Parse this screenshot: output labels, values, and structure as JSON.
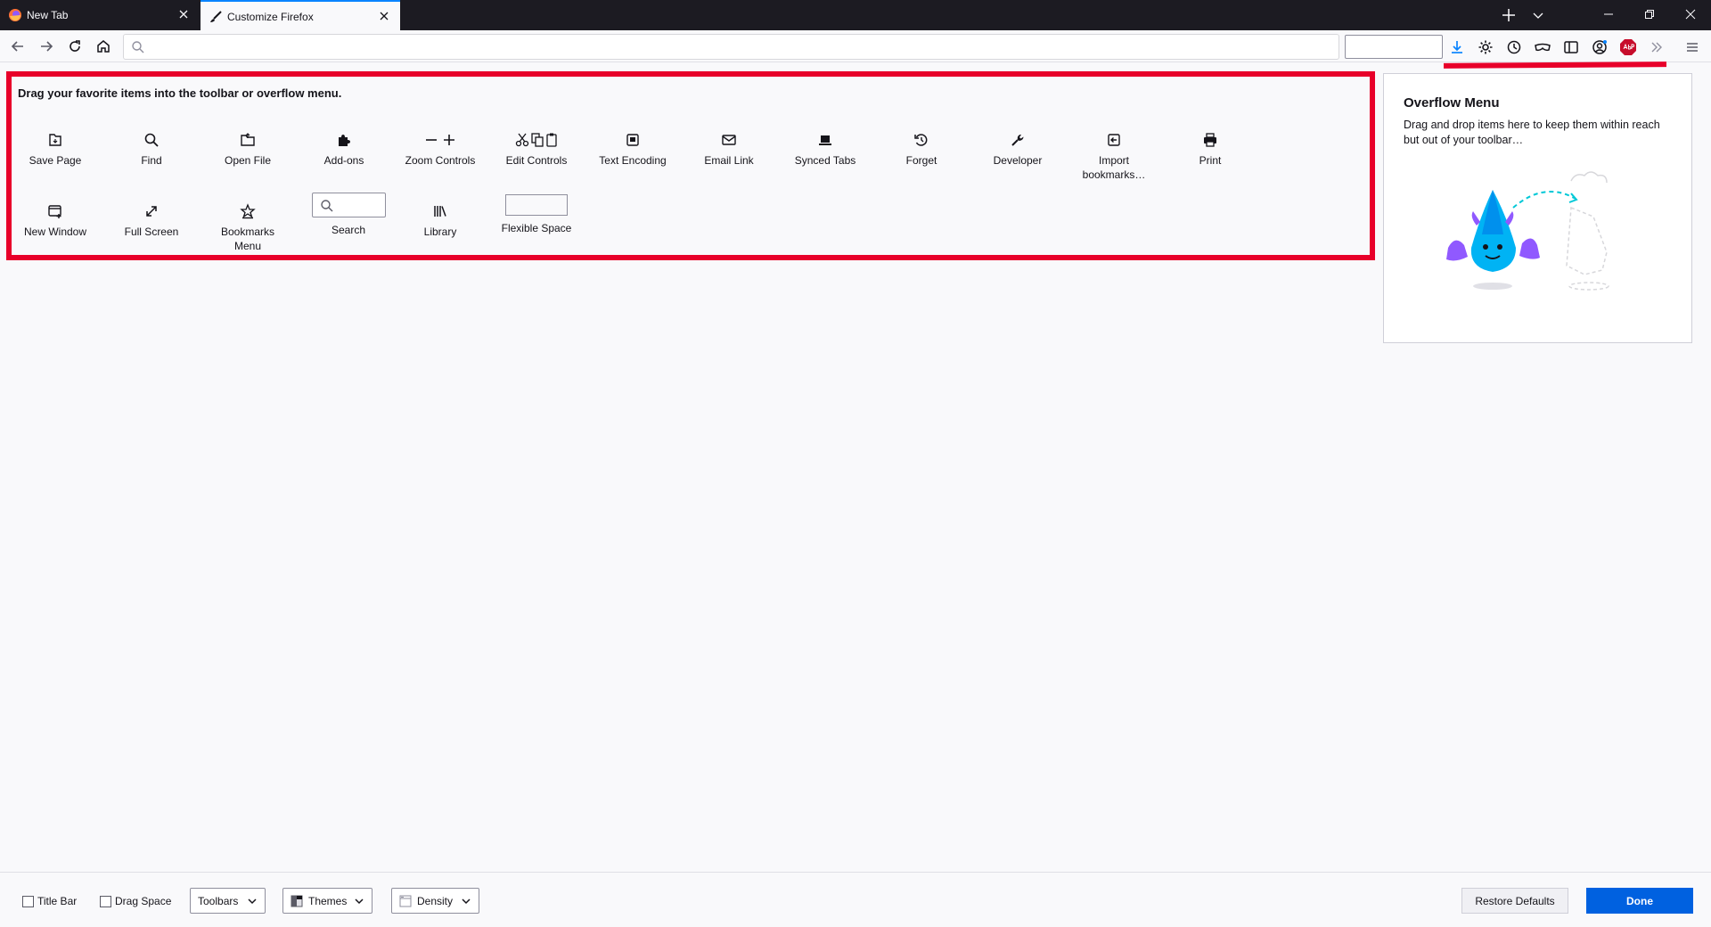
{
  "tabs": [
    {
      "label": "New Tab"
    },
    {
      "label": "Customize Firefox"
    }
  ],
  "palette": {
    "caption": "Drag your favorite items into the toolbar or overflow menu.",
    "items": [
      {
        "label": "Save Page",
        "icon": "save-page-icon"
      },
      {
        "label": "Find",
        "icon": "find-icon"
      },
      {
        "label": "Open File",
        "icon": "open-file-icon"
      },
      {
        "label": "Add-ons",
        "icon": "add-ons-icon"
      },
      {
        "label": "Zoom Controls",
        "icon": "zoom-controls-icon"
      },
      {
        "label": "Edit Controls",
        "icon": "edit-controls-icon"
      },
      {
        "label": "Text Encoding",
        "icon": "text-encoding-icon"
      },
      {
        "label": "Email Link",
        "icon": "email-link-icon"
      },
      {
        "label": "Synced Tabs",
        "icon": "synced-tabs-icon"
      },
      {
        "label": "Forget",
        "icon": "forget-icon"
      },
      {
        "label": "Developer",
        "icon": "developer-icon"
      },
      {
        "label": "Import bookmarks…",
        "icon": "import-bookmarks-icon"
      },
      {
        "label": "Print",
        "icon": "print-icon"
      },
      {
        "label": "New Window",
        "icon": "new-window-icon"
      },
      {
        "label": "Full Screen",
        "icon": "full-screen-icon"
      },
      {
        "label": "Bookmarks Menu",
        "icon": "bookmarks-menu-icon"
      },
      {
        "label": "Search",
        "icon": "search-icon"
      },
      {
        "label": "Library",
        "icon": "library-icon"
      },
      {
        "label": "Flexible Space",
        "icon": "flexible-space-icon"
      }
    ]
  },
  "overflow": {
    "title": "Overflow Menu",
    "description": "Drag and drop items here to keep them within reach but out of your toolbar…"
  },
  "footer": {
    "title_bar": "Title Bar",
    "drag_space": "Drag Space",
    "toolbars": "Toolbars",
    "themes": "Themes",
    "density": "Density",
    "restore_defaults": "Restore Defaults",
    "done": "Done"
  },
  "toolbar_icons": [
    "downloads-icon",
    "settings-icon",
    "history-icon",
    "private-browsing-icon",
    "sidebar-icon",
    "account-icon",
    "adblock-icon",
    "overflow-chevron-icon"
  ],
  "colors": {
    "annotation": "#e8002a",
    "done_button": "#0061e0",
    "tabstrip": "#1c1b22",
    "accent": "#0a84ff"
  }
}
